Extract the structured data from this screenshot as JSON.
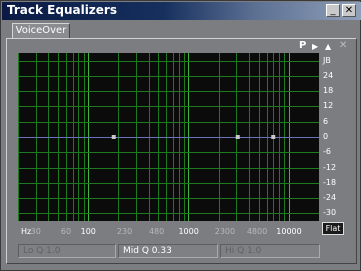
{
  "window": {
    "title": "Track Equalizers"
  },
  "tabs": [
    {
      "label": "VoiceOver"
    }
  ],
  "controls": {
    "p_label": "P",
    "play_glyph": "▶",
    "up_glyph": "▲",
    "close_glyph": "✕"
  },
  "titlebar_buttons": {
    "minimize_glyph": "_",
    "close_glyph": "✕"
  },
  "db_labels": [
    "JB",
    "24",
    "18",
    "12",
    "6",
    "0",
    "-6",
    "-12",
    "-18",
    "-24",
    "-30"
  ],
  "freq_labels": [
    {
      "text": "Hz",
      "color": "#ffffff"
    },
    {
      "text": "30",
      "color": "#b8b8b8"
    },
    {
      "text": "60",
      "color": "#b8b8b8"
    },
    {
      "text": "100",
      "color": "#ffffff"
    },
    {
      "text": "230",
      "color": "#b8b8b8"
    },
    {
      "text": "480",
      "color": "#b8b8b8"
    },
    {
      "text": "1000",
      "color": "#ffffff"
    },
    {
      "text": "2300",
      "color": "#b8b8b8"
    },
    {
      "text": "4800",
      "color": "#b8b8b8"
    },
    {
      "text": "10000",
      "color": "#ffffff"
    }
  ],
  "flat_button": {
    "label": "Flat"
  },
  "readouts": {
    "lo": "Lo Q  1.0",
    "mid": "Mid Q  0.33",
    "hi": "Hi Q  1.0"
  },
  "chart_data": {
    "type": "line",
    "x_scale": "log",
    "xlim_hz": [
      20,
      20000
    ],
    "ylim_db": [
      -33,
      33
    ],
    "series": [
      {
        "x": [
          20,
          20000
        ],
        "y": [
          0,
          0
        ]
      }
    ],
    "points": [
      {
        "x": 180,
        "y": 0
      },
      {
        "x": 3100,
        "y": 0
      },
      {
        "x": 7000,
        "y": 0
      }
    ],
    "grid": true,
    "colors": {
      "grid": "#1f7a1f",
      "major_grid": "#3fb43f",
      "curve": "#6b73b8",
      "point": "#c8c8c8"
    }
  }
}
